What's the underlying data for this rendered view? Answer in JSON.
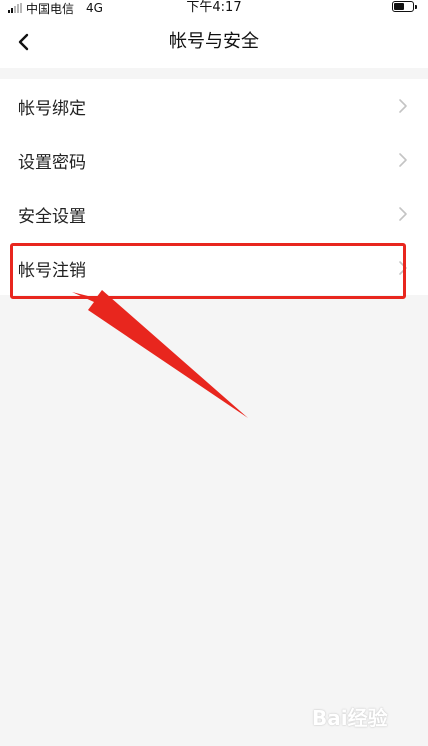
{
  "status_bar": {
    "carrier": "中国电信",
    "network": "4G",
    "time": "下午4:17",
    "battery_level": 0.6
  },
  "nav": {
    "title": "帐号与安全",
    "back_icon": "chevron-left-icon"
  },
  "menu": {
    "items": [
      {
        "label": "帐号绑定"
      },
      {
        "label": "设置密码"
      },
      {
        "label": "安全设置"
      },
      {
        "label": "帐号注销"
      }
    ]
  },
  "annotation": {
    "color": "#e8261e"
  },
  "watermark": {
    "text": "Bai经验"
  }
}
